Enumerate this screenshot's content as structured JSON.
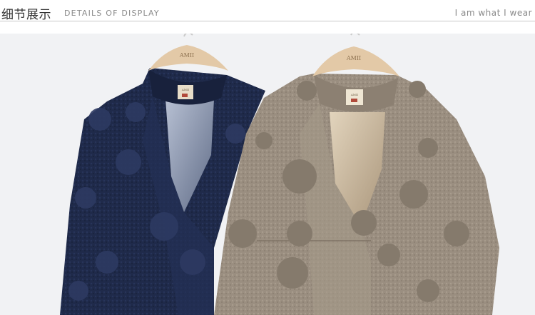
{
  "header": {
    "title_cn": "细节展示",
    "title_en": "DETAILS OF DISPLAY",
    "slogan": "I am what I wear"
  },
  "photo": {
    "hanger_logo_left": "AMII",
    "hanger_logo_right": "AMII",
    "tag_left": "AMII",
    "tag_right": "AMII"
  },
  "colors": {
    "navy_coat": "#1f2a4a",
    "taupe_coat": "#9a8e80",
    "hanger": "#e3c9a7",
    "background": "#f1f2f4",
    "divider": "#c9c9c9"
  }
}
